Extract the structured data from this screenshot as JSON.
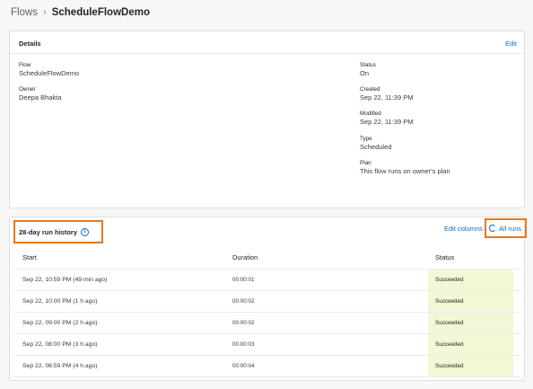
{
  "breadcrumb": {
    "root": "Flows",
    "separator": "›",
    "current": "ScheduleFlowDemo"
  },
  "details": {
    "title": "Details",
    "edit_label": "Edit",
    "flow_label": "Flow",
    "flow_value": "ScheduleFlowDemo",
    "owner_label": "Owner",
    "owner_value": "Deepa Bhakta",
    "status_label": "Status",
    "status_value": "On",
    "created_label": "Created",
    "created_value": "Sep 22, 11:39 PM",
    "modified_label": "Modified",
    "modified_value": "Sep 22, 11:39 PM",
    "type_label": "Type",
    "type_value": "Scheduled",
    "plan_label": "Plan",
    "plan_value": "This flow runs on owner's plan"
  },
  "runs": {
    "title": "28-day run history",
    "info_glyph": "i",
    "edit_columns_label": "Edit columns",
    "all_runs_label": "All runs",
    "columns": {
      "start": "Start",
      "duration": "Duration",
      "status": "Status"
    },
    "rows": [
      {
        "start": "Sep 22, 10:59 PM (49 min ago)",
        "duration": "00:00:01",
        "status": "Succeeded"
      },
      {
        "start": "Sep 22, 10:00 PM (1 h ago)",
        "duration": "00:00:02",
        "status": "Succeeded"
      },
      {
        "start": "Sep 22, 09:00 PM (2 h ago)",
        "duration": "00:00:02",
        "status": "Succeeded"
      },
      {
        "start": "Sep 22, 08:00 PM (3 h ago)",
        "duration": "00:00:03",
        "status": "Succeeded"
      },
      {
        "start": "Sep 22, 06:59 PM (4 h ago)",
        "duration": "00:00:04",
        "status": "Succeeded"
      }
    ]
  },
  "colors": {
    "accent": "#0f6cbd",
    "highlight_border": "#e8781e",
    "succeeded_bg": "#f0f8d6"
  },
  "icons": {
    "info": "info-icon",
    "refresh": "refresh-icon"
  }
}
